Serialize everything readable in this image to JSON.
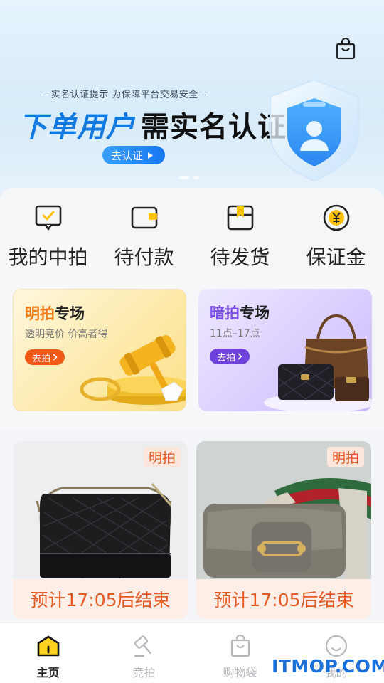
{
  "banner": {
    "subtitle": "– 实名认证提示 为保障平台交易安全 –",
    "title_part1": "下单用户",
    "title_part2": "需实名认证",
    "button_label": "去认证"
  },
  "quick_actions": [
    {
      "label": "我的中拍",
      "icon": "chat-check-icon"
    },
    {
      "label": "待付款",
      "icon": "wallet-icon"
    },
    {
      "label": "待发货",
      "icon": "package-icon"
    },
    {
      "label": "保证金",
      "icon": "yen-coin-icon"
    }
  ],
  "zones": [
    {
      "title_accent": "明拍",
      "title_rest": "专场",
      "subtitle": "透明竞价 价高者得",
      "button": "去拍"
    },
    {
      "title_accent": "暗拍",
      "title_rest": "专场",
      "subtitle": "11点–17点",
      "button": "去拍"
    }
  ],
  "products": [
    {
      "tag": "明拍",
      "countdown": "预计17:05后结束",
      "item": "black quilted hobo bag"
    },
    {
      "tag": "明拍",
      "countdown": "预计17:05后结束",
      "item": "grey horsebit shoulder bag"
    }
  ],
  "tabbar": [
    {
      "label": "主页",
      "icon": "home-icon",
      "active": true
    },
    {
      "label": "竞拍",
      "icon": "gavel-icon",
      "active": false
    },
    {
      "label": "购物袋",
      "icon": "shopping-bag-icon",
      "active": false
    },
    {
      "label": "我的",
      "icon": "smiley-icon",
      "active": false
    }
  ],
  "watermark": "ITMOP.COM",
  "colors": {
    "brand_blue": "#1279e0",
    "orange": "#f07a12",
    "purple": "#7b4fe6",
    "countdown": "#e65a22",
    "active_yellow": "#ffd21f"
  }
}
